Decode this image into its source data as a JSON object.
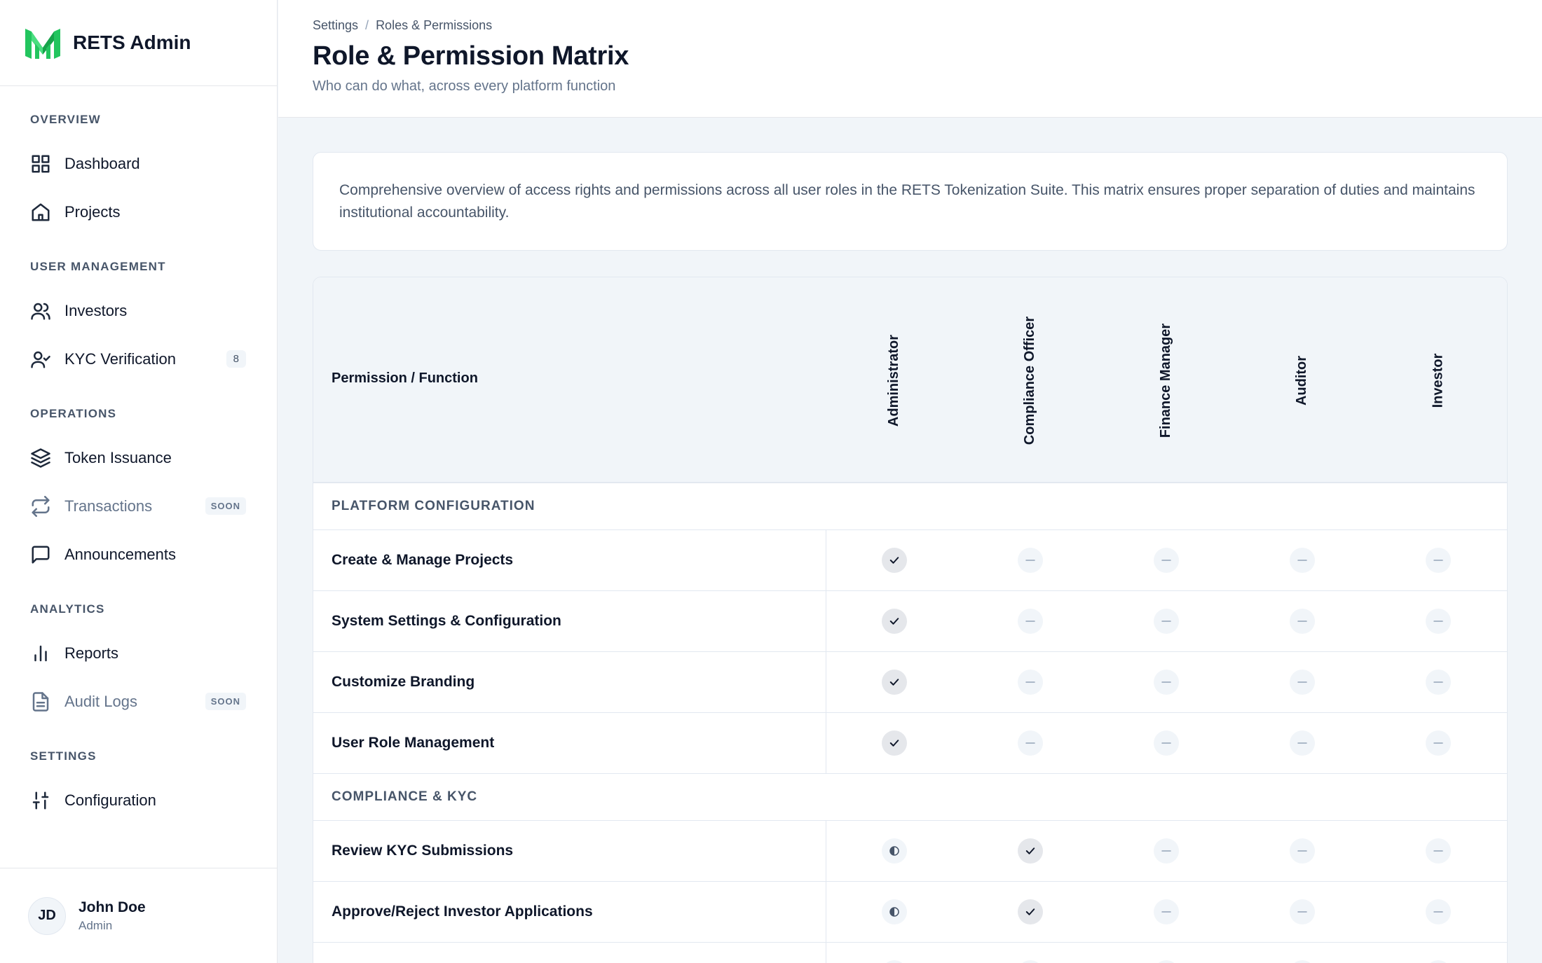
{
  "brand": {
    "name": "RETS Admin",
    "logo_color": "#22c55e"
  },
  "sidebar": {
    "sections": [
      {
        "title": "Overview",
        "items": [
          {
            "label": "Dashboard",
            "icon": "grid-icon"
          },
          {
            "label": "Projects",
            "icon": "home-icon"
          }
        ]
      },
      {
        "title": "User Management",
        "items": [
          {
            "label": "Investors",
            "icon": "users-icon"
          },
          {
            "label": "KYC Verification",
            "icon": "user-check-icon",
            "badge": "8"
          }
        ]
      },
      {
        "title": "Operations",
        "items": [
          {
            "label": "Token Issuance",
            "icon": "layers-icon"
          },
          {
            "label": "Transactions",
            "icon": "repeat-icon",
            "badge": "SOON"
          },
          {
            "label": "Announcements",
            "icon": "message-icon"
          }
        ]
      },
      {
        "title": "Analytics",
        "items": [
          {
            "label": "Reports",
            "icon": "bar-chart-icon"
          },
          {
            "label": "Audit Logs",
            "icon": "file-text-icon",
            "badge": "SOON"
          }
        ]
      },
      {
        "title": "Settings",
        "items": [
          {
            "label": "Configuration",
            "icon": "sliders-icon"
          }
        ]
      }
    ]
  },
  "user": {
    "initials": "JD",
    "name": "John Doe",
    "role": "Admin"
  },
  "header": {
    "breadcrumb": [
      "Settings",
      "Roles & Permissions"
    ],
    "title": "Role & Permission Matrix",
    "subtitle": "Who can do what, across every platform function"
  },
  "intro": "Comprehensive overview of access rights and permissions across all user roles in the RETS Tokenization Suite. This matrix ensures proper separation of duties and maintains institutional accountability.",
  "matrix": {
    "header_label": "Permission / Function",
    "roles": [
      "Administrator",
      "Compliance Officer",
      "Finance Manager",
      "Auditor",
      "Investor"
    ],
    "sections": [
      {
        "title": "Platform Configuration",
        "rows": [
          {
            "name": "Create & Manage Projects",
            "access": [
              "full",
              "none",
              "none",
              "none",
              "none"
            ]
          },
          {
            "name": "System Settings & Configuration",
            "access": [
              "full",
              "none",
              "none",
              "none",
              "none"
            ]
          },
          {
            "name": "Customize Branding",
            "access": [
              "full",
              "none",
              "none",
              "none",
              "none"
            ]
          },
          {
            "name": "User Role Management",
            "access": [
              "full",
              "none",
              "none",
              "none",
              "none"
            ]
          }
        ]
      },
      {
        "title": "Compliance & KYC",
        "rows": [
          {
            "name": "Review KYC Submissions",
            "access": [
              "partial",
              "full",
              "none",
              "none",
              "none"
            ]
          },
          {
            "name": "Approve/Reject Investor Applications",
            "access": [
              "partial",
              "full",
              "none",
              "none",
              "none"
            ]
          },
          {
            "name": "",
            "access": [
              "none",
              "none",
              "none",
              "none",
              "none"
            ]
          }
        ]
      }
    ]
  }
}
